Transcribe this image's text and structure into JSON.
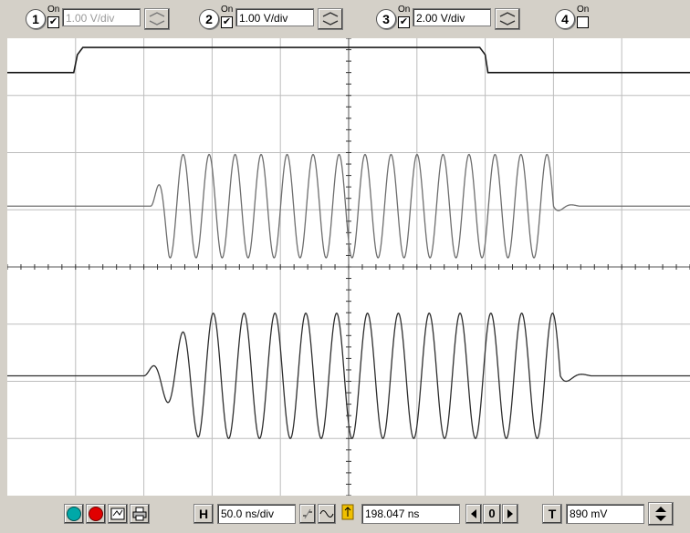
{
  "channels": [
    {
      "number": "1",
      "on_label": "On",
      "checked": true,
      "scale": "1.00 V/div",
      "enabled": false
    },
    {
      "number": "2",
      "on_label": "On",
      "checked": true,
      "scale": "1.00 V/div",
      "enabled": true
    },
    {
      "number": "3",
      "on_label": "On",
      "checked": true,
      "scale": "2.00 V/div",
      "enabled": true
    },
    {
      "number": "4",
      "on_label": "On",
      "checked": false
    }
  ],
  "colors": {
    "trace_1": "#1a1a1a",
    "trace_2": "#6e6e6e",
    "trace_3": "#2e2e2e",
    "grid": "#bdbdbd",
    "run_button": "#00a8a8",
    "stop_button": "#e00000"
  },
  "traces": {
    "ch1": {
      "kind": "gate_pulse",
      "high_from_div": 1.0,
      "high_to_div": 7.0
    },
    "ch2": {
      "kind": "burst",
      "start_div": 2.1,
      "end_div": 8.0,
      "cycles": 15.5
    },
    "ch3": {
      "kind": "burst",
      "start_div": 2.0,
      "end_div": 8.1,
      "cycles": 13.5
    }
  },
  "bottom": {
    "horizontal_label": "H",
    "timebase": "50.0 ns/div",
    "position": "198.047 ns",
    "ref_value": "0",
    "trigger_label": "T",
    "trigger_level": "890 mV"
  },
  "icons": [
    "run-icon",
    "stop-icon",
    "autoscale-icon",
    "print-icon",
    "dc-coupling-icon",
    "ac-coupling-icon",
    "trigger-marker-icon",
    "arrow-left-icon",
    "arrow-right-icon",
    "spin-up-icon",
    "spin-down-icon"
  ]
}
